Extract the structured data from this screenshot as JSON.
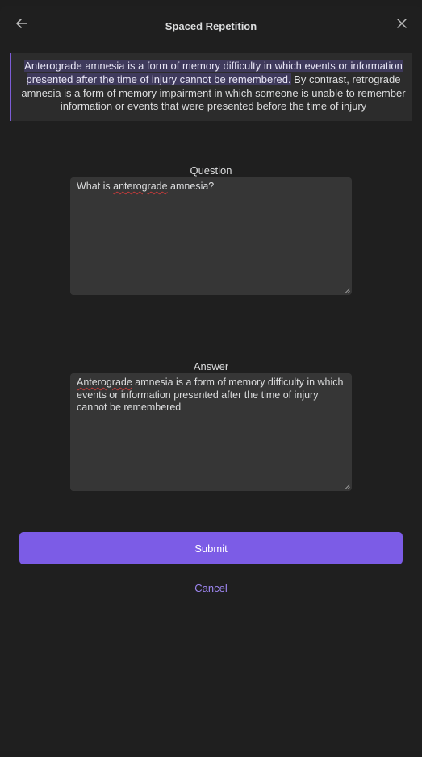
{
  "header": {
    "title": "Spaced Repetition",
    "back_icon": "arrow-left-icon",
    "close_icon": "close-icon"
  },
  "context": {
    "highlighted_text": "Anterograde amnesia is a form of memory difficulty in which events or information presented after the time of injury cannot be remembered.",
    "rest_text": " By contrast, retrograde amnesia is a form of memory impairment in which someone is unable to remember information or events that were presented before the time of injury"
  },
  "question": {
    "label": "Question",
    "value_before": "What is ",
    "value_misspelled": "anterograde",
    "value_after": " amnesia?"
  },
  "answer": {
    "label": "Answer",
    "value_misspelled": "Anterograde",
    "value_after": " amnesia is a form of memory difficulty in which events or information presented after the time of injury cannot be remembered"
  },
  "actions": {
    "submit_label": "Submit",
    "cancel_label": "Cancel"
  },
  "colors": {
    "accent": "#7c5ce6",
    "highlight": "#3f3a5c",
    "background": "#1f1f1f",
    "field": "#363636",
    "spellcheck": "#c23a3a"
  }
}
